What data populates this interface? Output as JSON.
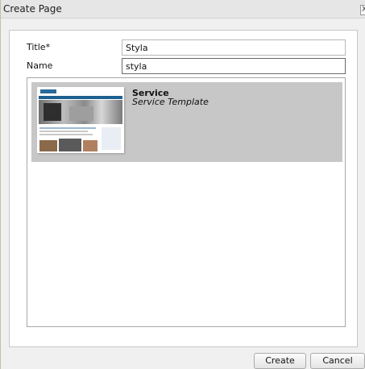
{
  "dialog": {
    "title": "Create Page",
    "close_glyph": "X"
  },
  "form": {
    "title_label": "Title*",
    "title_value": "Styla",
    "name_label": "Name",
    "name_value": "styla"
  },
  "templates": [
    {
      "name": "Service",
      "description": "Service Template",
      "thumbnail": "service-template-thumbnail",
      "selected": true
    }
  ],
  "buttons": {
    "create_label": "Create",
    "cancel_label": "Cancel"
  },
  "colors": {
    "selected_item_bg": "#c7c7c7",
    "dialog_bg": "#f0f0f0"
  }
}
